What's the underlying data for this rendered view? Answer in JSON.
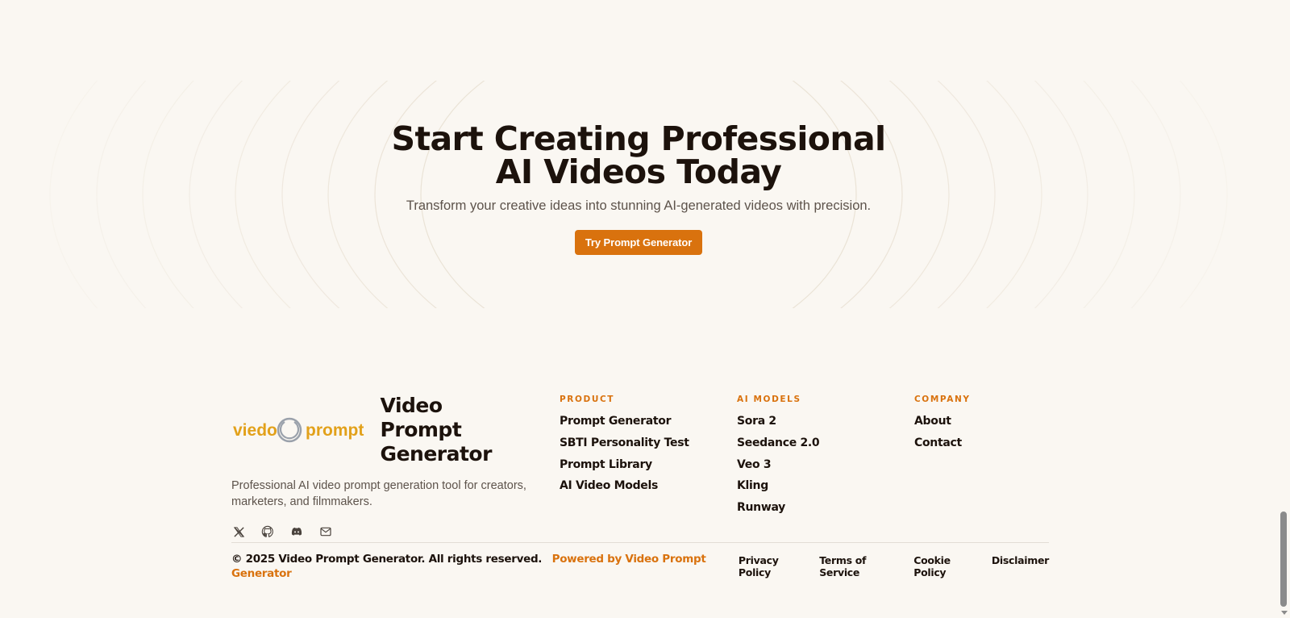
{
  "cta": {
    "title_line1": "Start Creating Professional",
    "title_line2": "AI Videos Today",
    "subtitle": "Transform your creative ideas into stunning AI-generated videos with precision.",
    "button_label": "Try Prompt Generator"
  },
  "brand": {
    "logo_left": "viedo",
    "logo_right": "prompt",
    "name_line1": "Video Prompt",
    "name_line2": "Generator",
    "description": "Professional AI video prompt generation tool for creators, marketers, and filmmakers.",
    "socials": [
      "x-icon",
      "github-icon",
      "discord-icon",
      "mail-icon"
    ]
  },
  "columns": [
    {
      "heading": "PRODUCT",
      "links": [
        "Prompt Generator",
        "SBTI Personality Test",
        "Prompt Library",
        "AI Video Models"
      ]
    },
    {
      "heading": "AI MODELS",
      "links": [
        "Sora 2",
        "Seedance 2.0",
        "Veo 3",
        "Kling",
        "Runway"
      ]
    },
    {
      "heading": "COMPANY",
      "links": [
        "About",
        "Contact"
      ]
    }
  ],
  "bottom": {
    "copyright": "© 2025 Video Prompt Generator. All rights reserved.",
    "powered": "Powered by Video Prompt Generator",
    "legal": [
      "Privacy Policy",
      "Terms of Service",
      "Cookie Policy",
      "Disclaimer"
    ]
  },
  "colors": {
    "accent": "#d9720e",
    "background": "#faf7f2",
    "text": "#1c120c",
    "muted": "#5d534b"
  }
}
